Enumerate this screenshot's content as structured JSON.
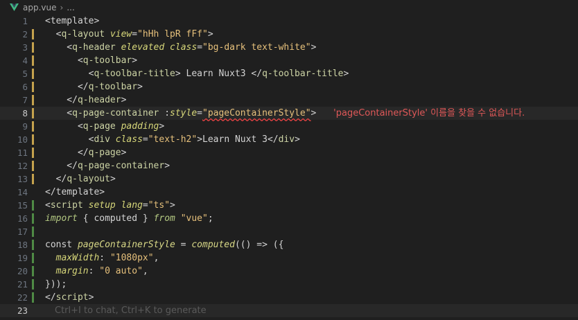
{
  "breadcrumb": {
    "file": "app.vue",
    "more": "..."
  },
  "lines": [
    {
      "n": "1",
      "bar": "",
      "tokens": [
        [
          "t-punc",
          "<template>"
        ]
      ]
    },
    {
      "n": "2",
      "bar": "mod",
      "tokens": [
        [
          "t-punc",
          "  <"
        ],
        [
          "t-tag",
          "q-layout"
        ],
        [
          "t-punc",
          " "
        ],
        [
          "t-attr",
          "view"
        ],
        [
          "t-punc",
          "="
        ],
        [
          "t-str",
          "\"hHh lpR fFf\""
        ],
        [
          "t-punc",
          ">"
        ]
      ]
    },
    {
      "n": "3",
      "bar": "mod",
      "tokens": [
        [
          "t-punc",
          "    <"
        ],
        [
          "t-tag",
          "q-header"
        ],
        [
          "t-punc",
          " "
        ],
        [
          "t-attr",
          "elevated"
        ],
        [
          "t-punc",
          " "
        ],
        [
          "t-attr",
          "class"
        ],
        [
          "t-punc",
          "="
        ],
        [
          "t-str",
          "\"bg-dark text-white\""
        ],
        [
          "t-punc",
          ">"
        ]
      ]
    },
    {
      "n": "4",
      "bar": "mod",
      "tokens": [
        [
          "t-punc",
          "      <"
        ],
        [
          "t-tag",
          "q-toolbar"
        ],
        [
          "t-punc",
          ">"
        ]
      ]
    },
    {
      "n": "5",
      "bar": "mod",
      "tokens": [
        [
          "t-punc",
          "        <"
        ],
        [
          "t-tag",
          "q-toolbar-title"
        ],
        [
          "t-punc",
          "> "
        ],
        [
          "t-text",
          "Learn Nuxt3"
        ],
        [
          "t-punc",
          " </"
        ],
        [
          "t-tag",
          "q-toolbar-title"
        ],
        [
          "t-punc",
          ">"
        ]
      ]
    },
    {
      "n": "6",
      "bar": "mod",
      "tokens": [
        [
          "t-punc",
          "      </"
        ],
        [
          "t-tag",
          "q-toolbar"
        ],
        [
          "t-punc",
          ">"
        ]
      ]
    },
    {
      "n": "7",
      "bar": "mod",
      "tokens": [
        [
          "t-punc",
          "    </"
        ],
        [
          "t-tag",
          "q-header"
        ],
        [
          "t-punc",
          ">"
        ]
      ]
    },
    {
      "n": "8",
      "bar": "mod",
      "active": true,
      "tokens": [
        [
          "t-punc",
          "    <"
        ],
        [
          "t-tag",
          "q-page-container"
        ],
        [
          "t-punc",
          " :"
        ],
        [
          "t-attr",
          "style"
        ],
        [
          "t-punc",
          "="
        ],
        [
          "t-str t-err",
          "\"pageContainerStyle\""
        ],
        [
          "t-punc",
          ">"
        ]
      ],
      "diagnostic": "'pageContainerStyle' 이름을 찾을 수 없습니다."
    },
    {
      "n": "9",
      "bar": "mod",
      "tokens": [
        [
          "t-punc",
          "      <"
        ],
        [
          "t-tag",
          "q-page"
        ],
        [
          "t-punc",
          " "
        ],
        [
          "t-attr",
          "padding"
        ],
        [
          "t-punc",
          ">"
        ]
      ]
    },
    {
      "n": "10",
      "bar": "mod",
      "tokens": [
        [
          "t-punc",
          "        <"
        ],
        [
          "t-tag",
          "div"
        ],
        [
          "t-punc",
          " "
        ],
        [
          "t-attr",
          "class"
        ],
        [
          "t-punc",
          "="
        ],
        [
          "t-str",
          "\"text-h2\""
        ],
        [
          "t-punc",
          ">"
        ],
        [
          "t-text",
          "Learn Nuxt 3"
        ],
        [
          "t-punc",
          "</"
        ],
        [
          "t-tag",
          "div"
        ],
        [
          "t-punc",
          ">"
        ]
      ]
    },
    {
      "n": "11",
      "bar": "mod",
      "tokens": [
        [
          "t-punc",
          "      </"
        ],
        [
          "t-tag",
          "q-page"
        ],
        [
          "t-punc",
          ">"
        ]
      ]
    },
    {
      "n": "12",
      "bar": "mod",
      "tokens": [
        [
          "t-punc",
          "    </"
        ],
        [
          "t-tag",
          "q-page-container"
        ],
        [
          "t-punc",
          ">"
        ]
      ]
    },
    {
      "n": "13",
      "bar": "mod",
      "tokens": [
        [
          "t-punc",
          "  </"
        ],
        [
          "t-tag",
          "q-layout"
        ],
        [
          "t-punc",
          ">"
        ]
      ]
    },
    {
      "n": "14",
      "bar": "",
      "tokens": [
        [
          "t-punc",
          "</template>"
        ]
      ]
    },
    {
      "n": "15",
      "bar": "add",
      "tokens": [
        [
          "t-punc",
          "<"
        ],
        [
          "t-tag",
          "script"
        ],
        [
          "t-punc",
          " "
        ],
        [
          "t-attr",
          "setup"
        ],
        [
          "t-punc",
          " "
        ],
        [
          "t-attr",
          "lang"
        ],
        [
          "t-punc",
          "="
        ],
        [
          "t-str",
          "\"ts\""
        ],
        [
          "t-punc",
          ">"
        ]
      ]
    },
    {
      "n": "16",
      "bar": "add",
      "tokens": [
        [
          "t-kw",
          "import"
        ],
        [
          "t-punc",
          " { "
        ],
        [
          "t-text",
          "computed"
        ],
        [
          "t-punc",
          " } "
        ],
        [
          "t-kw",
          "from"
        ],
        [
          "t-punc",
          " "
        ],
        [
          "t-str",
          "\"vue\""
        ],
        [
          "t-punc",
          ";"
        ]
      ]
    },
    {
      "n": "17",
      "bar": "add",
      "tokens": []
    },
    {
      "n": "18",
      "bar": "add",
      "tokens": [
        [
          "t-text",
          "const "
        ],
        [
          "t-fn",
          "pageContainerStyle"
        ],
        [
          "t-punc",
          " = "
        ],
        [
          "t-fn",
          "computed"
        ],
        [
          "t-punc",
          "(() => ({"
        ]
      ]
    },
    {
      "n": "19",
      "bar": "add",
      "tokens": [
        [
          "t-punc",
          "  "
        ],
        [
          "t-attr",
          "maxWidth"
        ],
        [
          "t-punc",
          ": "
        ],
        [
          "t-str",
          "\"1080px\""
        ],
        [
          "t-punc",
          ","
        ]
      ]
    },
    {
      "n": "20",
      "bar": "add",
      "tokens": [
        [
          "t-punc",
          "  "
        ],
        [
          "t-attr",
          "margin"
        ],
        [
          "t-punc",
          ": "
        ],
        [
          "t-str",
          "\"0 auto\""
        ],
        [
          "t-punc",
          ","
        ]
      ]
    },
    {
      "n": "21",
      "bar": "add",
      "tokens": [
        [
          "t-punc",
          "}));"
        ]
      ]
    },
    {
      "n": "22",
      "bar": "add",
      "tokens": [
        [
          "t-punc",
          "</"
        ],
        [
          "t-tag",
          "script"
        ],
        [
          "t-punc",
          ">"
        ]
      ]
    },
    {
      "n": "23",
      "bar": "",
      "active": true,
      "tokens": [],
      "hint": "Ctrl+I to chat, Ctrl+K to generate"
    }
  ]
}
